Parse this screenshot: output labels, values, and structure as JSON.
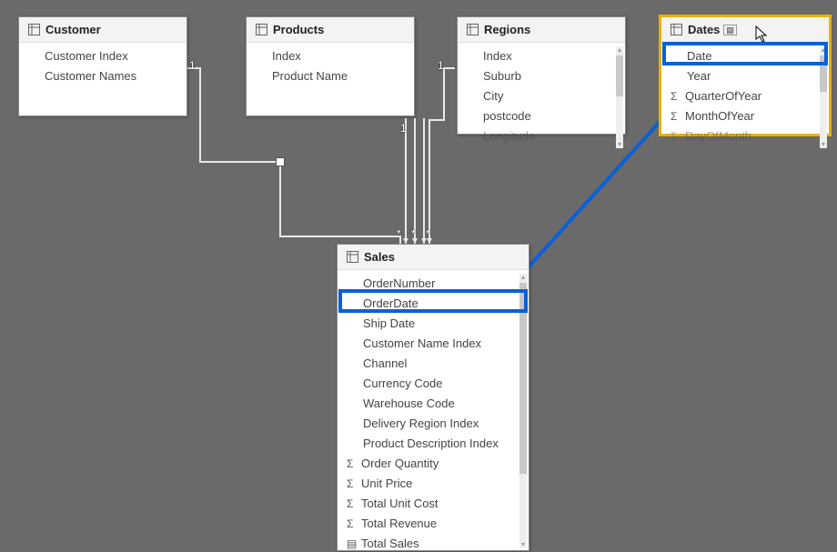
{
  "tables": {
    "customer": {
      "title": "Customer",
      "fields": [
        {
          "label": "Customer Index",
          "kind": "plain"
        },
        {
          "label": "Customer Names",
          "kind": "plain"
        }
      ]
    },
    "products": {
      "title": "Products",
      "fields": [
        {
          "label": "Index",
          "kind": "plain"
        },
        {
          "label": "Product Name",
          "kind": "plain"
        }
      ]
    },
    "regions": {
      "title": "Regions",
      "fields": [
        {
          "label": "Index",
          "kind": "plain"
        },
        {
          "label": "Suburb",
          "kind": "plain"
        },
        {
          "label": "City",
          "kind": "plain"
        },
        {
          "label": "postcode",
          "kind": "plain"
        },
        {
          "label": "Longitude",
          "kind": "plain"
        }
      ]
    },
    "dates": {
      "title": "Dates",
      "fields": [
        {
          "label": "Date",
          "kind": "plain"
        },
        {
          "label": "Year",
          "kind": "plain"
        },
        {
          "label": "QuarterOfYear",
          "kind": "sigma"
        },
        {
          "label": "MonthOfYear",
          "kind": "sigma"
        },
        {
          "label": "DayOfMonth",
          "kind": "sigma"
        }
      ]
    },
    "sales": {
      "title": "Sales",
      "fields": [
        {
          "label": "OrderNumber",
          "kind": "plain"
        },
        {
          "label": "OrderDate",
          "kind": "plain"
        },
        {
          "label": "Ship Date",
          "kind": "plain"
        },
        {
          "label": "Customer Name Index",
          "kind": "plain"
        },
        {
          "label": "Channel",
          "kind": "plain"
        },
        {
          "label": "Currency Code",
          "kind": "plain"
        },
        {
          "label": "Warehouse Code",
          "kind": "plain"
        },
        {
          "label": "Delivery Region Index",
          "kind": "plain"
        },
        {
          "label": "Product Description Index",
          "kind": "plain"
        },
        {
          "label": "Order Quantity",
          "kind": "sigma"
        },
        {
          "label": "Unit Price",
          "kind": "sigma"
        },
        {
          "label": "Total Unit Cost",
          "kind": "sigma"
        },
        {
          "label": "Total Revenue",
          "kind": "sigma"
        },
        {
          "label": "Total Sales",
          "kind": "datetbl"
        }
      ]
    }
  },
  "cardinality": {
    "one": "1",
    "many": "*"
  },
  "highlight_link": {
    "from_table": "Dates",
    "from_field": "Date",
    "to_table": "Sales",
    "to_field": "OrderDate"
  }
}
